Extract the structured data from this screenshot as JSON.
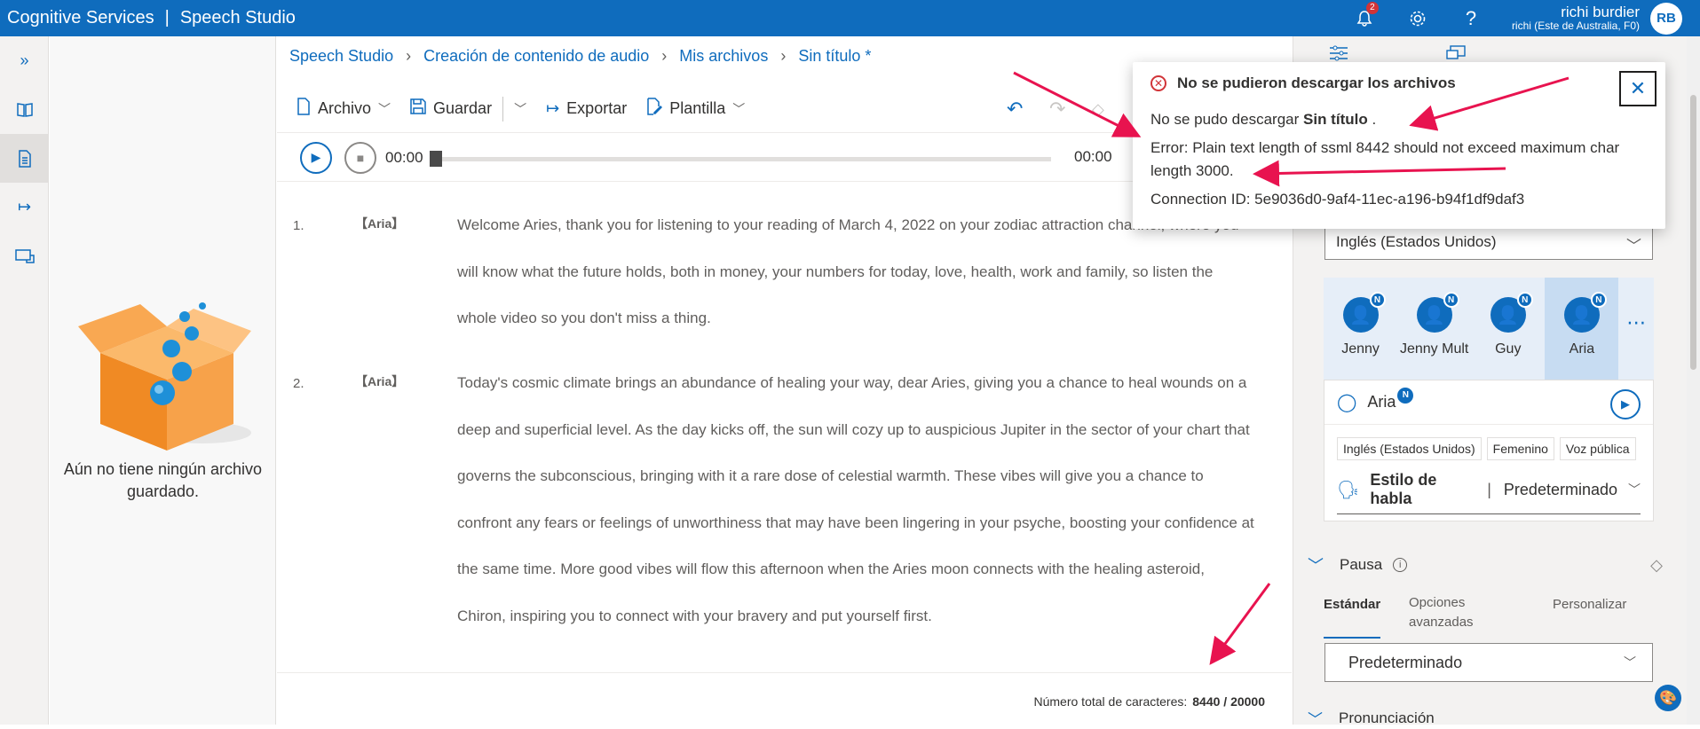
{
  "topbar": {
    "brand": "Cognitive Services",
    "brand_separator": "|",
    "product": "Speech Studio",
    "notification_count": "2",
    "user_name": "richi burdier",
    "user_sub": "richi (Este de Australia, F0)",
    "avatar_initials": "RB"
  },
  "files": {
    "empty_message": "Aún no tiene ningún archivo guardado."
  },
  "breadcrumb": [
    "Speech Studio",
    "Creación de contenido de audio",
    "Mis archivos",
    "Sin título *"
  ],
  "toolbar": {
    "archivo": "Archivo",
    "guardar": "Guardar",
    "exportar": "Exportar",
    "plantilla": "Plantilla"
  },
  "player": {
    "current_time": "00:00",
    "end_time": "00:00",
    "progress": 0
  },
  "paragraphs": [
    {
      "num": "1.",
      "voice": "【Aria】",
      "text": "Welcome Aries, thank you for listening to your reading of March 4, 2022 on your zodiac attraction channel, where you will know what the future holds, both in money, your numbers for today, love, health, work and family, so listen the whole video so you don't miss a thing."
    },
    {
      "num": "2.",
      "voice": "【Aria】",
      "text": "Today's cosmic climate brings an abundance of healing your way, dear Aries, giving you a chance to heal wounds on a deep and superficial level. As the day kicks off, the sun will cozy up to auspicious Jupiter in the sector of your chart that governs the subconscious, bringing with it a rare dose of celestial warmth. These vibes will give you a chance to confront any fears or feelings of unworthiness that may have been lingering in your psyche, boosting your confidence at the same time. More good vibes will flow this afternoon when the Aries moon connects with the healing asteroid, Chiron, inspiring you to connect with your bravery and put yourself first."
    }
  ],
  "char_count": {
    "label": "Número total de caracteres:",
    "value": "8440 / 20000"
  },
  "right_panel": {
    "language": "Inglés (Estados Unidos)",
    "voices": [
      {
        "name": "Jenny",
        "badge": "N"
      },
      {
        "name": "Jenny Mult",
        "badge": "N"
      },
      {
        "name": "Guy",
        "badge": "N"
      },
      {
        "name": "Aria",
        "badge": "N"
      }
    ],
    "more": "⋯",
    "selected_voice": "Aria",
    "selected_badge": "N",
    "tags": [
      "Inglés (Estados Unidos)",
      "Femenino",
      "Voz pública"
    ],
    "style_label": "Estilo de habla",
    "style_separator": "|",
    "style_value": "Predeterminado",
    "pausa_label": "Pausa",
    "pausa_tabs": [
      "Estándar",
      "Opciones avanzadas",
      "Personalizar"
    ],
    "pausa_value": "Predeterminado",
    "pron_label": "Pronunciación"
  },
  "error_popup": {
    "title": "No se pudieron descargar los archivos",
    "line1_prefix": "No se pudo descargar",
    "line1_file": "Sin título",
    "line1_suffix": ".",
    "error": "Error: Plain text length of ssml 8442 should not exceed maximum char length 3000.",
    "connection": "Connection ID: 5e9036d0-9af4-11ec-a196-b94f1df9daf3"
  },
  "colors": {
    "accent": "#0f6cbd",
    "error": "#d13438",
    "annotation_arrow": "#e8134f"
  }
}
